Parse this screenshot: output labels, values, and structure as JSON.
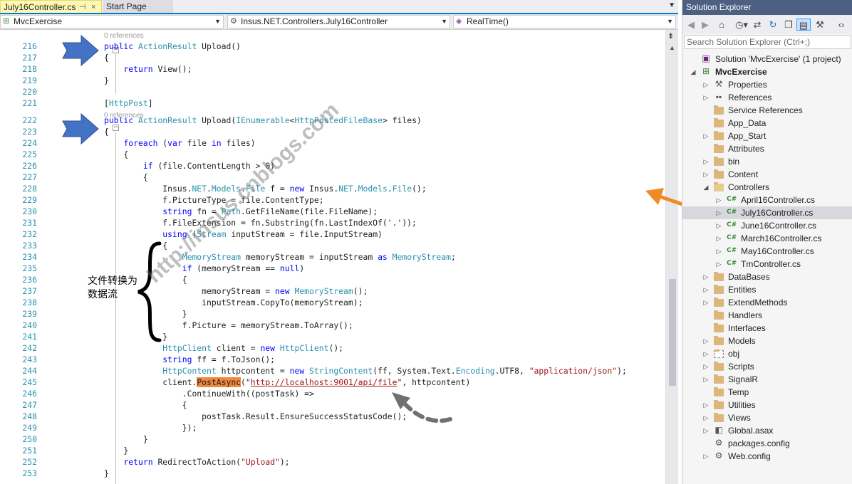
{
  "tabs": {
    "active_label": "July16Controller.cs",
    "pin_glyph": "⊣",
    "close_glyph": "×",
    "start_label": "Start Page"
  },
  "navbar": {
    "project": "MvcExercise",
    "class": "Insus.NET.Controllers.July16Controller",
    "member": "RealTime()"
  },
  "code": {
    "ref_label": "0 references",
    "lines": [
      {
        "n": "216",
        "t": "public ActionResult Upload()"
      },
      {
        "n": "217",
        "t": "{"
      },
      {
        "n": "218",
        "t": "    return View();"
      },
      {
        "n": "219",
        "t": "}"
      },
      {
        "n": "220",
        "t": ""
      },
      {
        "n": "221",
        "t": "[HttpPost]"
      },
      {
        "n": "222",
        "t": "public ActionResult Upload(IEnumerable<HttpPostedFileBase> files)"
      },
      {
        "n": "223",
        "t": "{"
      },
      {
        "n": "224",
        "t": "    foreach (var file in files)"
      },
      {
        "n": "225",
        "t": "    {"
      },
      {
        "n": "226",
        "t": "        if (file.ContentLength > 0)"
      },
      {
        "n": "227",
        "t": "        {"
      },
      {
        "n": "228",
        "t": "            Insus.NET.Models.File f = new Insus.NET.Models.File();"
      },
      {
        "n": "229",
        "t": "            f.PictureType = file.ContentType;"
      },
      {
        "n": "230",
        "t": "            string fn = Path.GetFileName(file.FileName);"
      },
      {
        "n": "231",
        "t": "            f.FileExtension = fn.Substring(fn.LastIndexOf('.'));"
      },
      {
        "n": "232",
        "t": "            using (Stream inputStream = file.InputStream)"
      },
      {
        "n": "233",
        "t": "            {"
      },
      {
        "n": "234",
        "t": "                MemoryStream memoryStream = inputStream as MemoryStream;"
      },
      {
        "n": "235",
        "t": "                if (memoryStream == null)"
      },
      {
        "n": "236",
        "t": "                {"
      },
      {
        "n": "237",
        "t": "                    memoryStream = new MemoryStream();"
      },
      {
        "n": "238",
        "t": "                    inputStream.CopyTo(memoryStream);"
      },
      {
        "n": "239",
        "t": "                }"
      },
      {
        "n": "240",
        "t": "                f.Picture = memoryStream.ToArray();"
      },
      {
        "n": "241",
        "t": "            }"
      },
      {
        "n": "242",
        "t": "            HttpClient client = new HttpClient();"
      },
      {
        "n": "243",
        "t": "            string ff = f.ToJson();"
      },
      {
        "n": "244",
        "t": "            HttpContent httpcontent = new StringContent(ff, System.Text.Encoding.UTF8, \"application/json\");"
      },
      {
        "n": "245",
        "t": "            client.PostAsync(\"http://localhost:9001/api/file\", httpcontent)"
      },
      {
        "n": "246",
        "t": "                .ContinueWith((postTask) =>"
      },
      {
        "n": "247",
        "t": "                {"
      },
      {
        "n": "248",
        "t": "                    postTask.Result.EnsureSuccessStatusCode();"
      },
      {
        "n": "249",
        "t": "                });"
      },
      {
        "n": "250",
        "t": "        }"
      },
      {
        "n": "251",
        "t": "    }"
      },
      {
        "n": "252",
        "t": "    return RedirectToAction(\"Upload\");"
      },
      {
        "n": "253",
        "t": "}"
      }
    ]
  },
  "annotations": {
    "brace_label": "文件转换为数据流",
    "watermark": "http://insus.cnblogs.com",
    "colors": {
      "blue_arrow": "#4472c4",
      "orange_arrow": "#f08a24",
      "gray_arrow": "#707070",
      "highlight": "#f0883e"
    }
  },
  "solution_explorer": {
    "title": "Solution Explorer",
    "search_placeholder": "Search Solution Explorer (Ctrl+;)",
    "toolbar_icons": [
      "back-icon",
      "forward-icon",
      "home-icon",
      "history-icon",
      "sync-icon",
      "refresh-icon",
      "collapse-all-icon",
      "show-all-files-icon",
      "code-view-icon",
      "properties-icon"
    ],
    "tree": [
      {
        "label": "Solution 'MvcExercise' (1 project)",
        "depth": 0,
        "icon": "solution-icon",
        "exp": "",
        "bold": false
      },
      {
        "label": "MvcExercise",
        "depth": 0,
        "icon": "web-project-icon",
        "exp": "open",
        "bold": true
      },
      {
        "label": "Properties",
        "depth": 1,
        "icon": "wrench-icon",
        "exp": "closed"
      },
      {
        "label": "References",
        "depth": 1,
        "icon": "references-icon",
        "exp": "closed"
      },
      {
        "label": "Service References",
        "depth": 1,
        "icon": "folder-icon",
        "exp": ""
      },
      {
        "label": "App_Data",
        "depth": 1,
        "icon": "folder-icon",
        "exp": ""
      },
      {
        "label": "App_Start",
        "depth": 1,
        "icon": "folder-icon",
        "exp": "closed"
      },
      {
        "label": "Attributes",
        "depth": 1,
        "icon": "folder-icon",
        "exp": ""
      },
      {
        "label": "bin",
        "depth": 1,
        "icon": "folder-icon",
        "exp": "closed"
      },
      {
        "label": "Content",
        "depth": 1,
        "icon": "folder-icon",
        "exp": "closed"
      },
      {
        "label": "Controllers",
        "depth": 1,
        "icon": "folder-open-icon",
        "exp": "open"
      },
      {
        "label": "April16Controller.cs",
        "depth": 2,
        "icon": "csharp-icon",
        "exp": "closed"
      },
      {
        "label": "July16Controller.cs",
        "depth": 2,
        "icon": "csharp-icon",
        "exp": "closed",
        "selected": true
      },
      {
        "label": "June16Controller.cs",
        "depth": 2,
        "icon": "csharp-icon",
        "exp": "closed"
      },
      {
        "label": "March16Controller.cs",
        "depth": 2,
        "icon": "csharp-icon",
        "exp": "closed"
      },
      {
        "label": "May16Controller.cs",
        "depth": 2,
        "icon": "csharp-icon",
        "exp": "closed"
      },
      {
        "label": "TmController.cs",
        "depth": 2,
        "icon": "csharp-icon",
        "exp": "closed"
      },
      {
        "label": "DataBases",
        "depth": 1,
        "icon": "folder-icon",
        "exp": "closed"
      },
      {
        "label": "Entities",
        "depth": 1,
        "icon": "folder-icon",
        "exp": "closed"
      },
      {
        "label": "ExtendMethods",
        "depth": 1,
        "icon": "folder-icon",
        "exp": "closed"
      },
      {
        "label": "Handlers",
        "depth": 1,
        "icon": "folder-icon",
        "exp": ""
      },
      {
        "label": "Interfaces",
        "depth": 1,
        "icon": "folder-icon",
        "exp": ""
      },
      {
        "label": "Models",
        "depth": 1,
        "icon": "folder-icon",
        "exp": "closed"
      },
      {
        "label": "obj",
        "depth": 1,
        "icon": "folder-dotted-icon",
        "exp": "closed"
      },
      {
        "label": "Scripts",
        "depth": 1,
        "icon": "folder-icon",
        "exp": "closed"
      },
      {
        "label": "SignalR",
        "depth": 1,
        "icon": "folder-icon",
        "exp": "closed"
      },
      {
        "label": "Temp",
        "depth": 1,
        "icon": "folder-icon",
        "exp": ""
      },
      {
        "label": "Utilities",
        "depth": 1,
        "icon": "folder-icon",
        "exp": "closed"
      },
      {
        "label": "Views",
        "depth": 1,
        "icon": "folder-icon",
        "exp": "closed"
      },
      {
        "label": "Global.asax",
        "depth": 1,
        "icon": "asax-icon",
        "exp": "closed"
      },
      {
        "label": "packages.config",
        "depth": 1,
        "icon": "config-icon",
        "exp": ""
      },
      {
        "label": "Web.config",
        "depth": 1,
        "icon": "config-icon",
        "exp": "closed"
      }
    ]
  }
}
